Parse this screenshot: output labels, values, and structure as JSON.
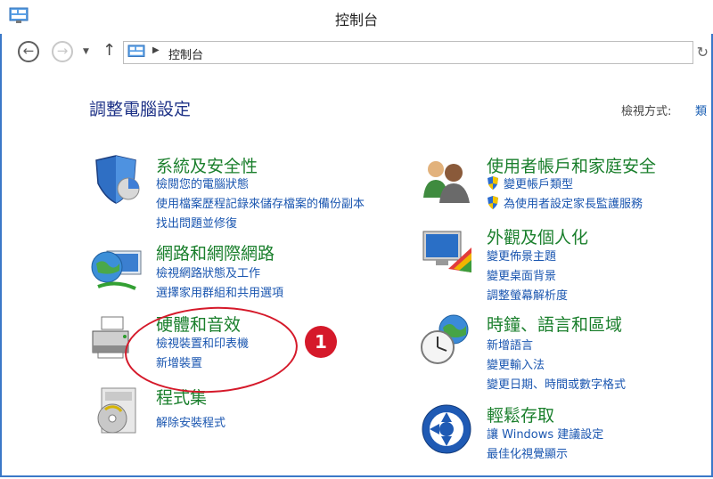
{
  "window": {
    "title": "控制台"
  },
  "address_bar": {
    "path": "控制台"
  },
  "page": {
    "heading": "調整電腦設定",
    "view_by_label": "檢視方式:",
    "view_by_value": "類"
  },
  "categories": [
    {
      "title": "系統及安全性",
      "icon": "shield-icon",
      "links": [
        "檢閱您的電腦狀態",
        "使用檔案歷程記錄來儲存檔案的備份副本",
        "找出問題並修復"
      ]
    },
    {
      "title": "網路和網際網路",
      "icon": "network-globe-icon",
      "links": [
        "檢視網路狀態及工作",
        "選擇家用群組和共用選項"
      ]
    },
    {
      "title": "硬體和音效",
      "icon": "printer-icon",
      "links": [
        "檢視裝置和印表機",
        "新增裝置"
      ]
    },
    {
      "title": "程式集",
      "icon": "programs-disc-icon",
      "links": [
        "解除安裝程式"
      ]
    },
    {
      "title": "使用者帳戶和家庭安全",
      "icon": "users-icon",
      "links": [
        "變更帳戶類型",
        "為使用者設定家長監護服務"
      ]
    },
    {
      "title": "外觀及個人化",
      "icon": "monitor-palette-icon",
      "links": [
        "變更佈景主題",
        "變更桌面背景",
        "調整螢幕解析度"
      ]
    },
    {
      "title": "時鐘、語言和區域",
      "icon": "clock-globe-icon",
      "links": [
        "新增語言",
        "變更輸入法",
        "變更日期、時間或數字格式"
      ]
    },
    {
      "title": "輕鬆存取",
      "icon": "ease-of-access-icon",
      "links": [
        "讓 Windows 建議設定",
        "最佳化視覺顯示"
      ]
    }
  ],
  "annotation": {
    "badge": "1"
  },
  "colors": {
    "category_title": "#1a7f2c",
    "link": "#1a56b0",
    "heading": "#1e3287",
    "callout": "#d5192a"
  }
}
